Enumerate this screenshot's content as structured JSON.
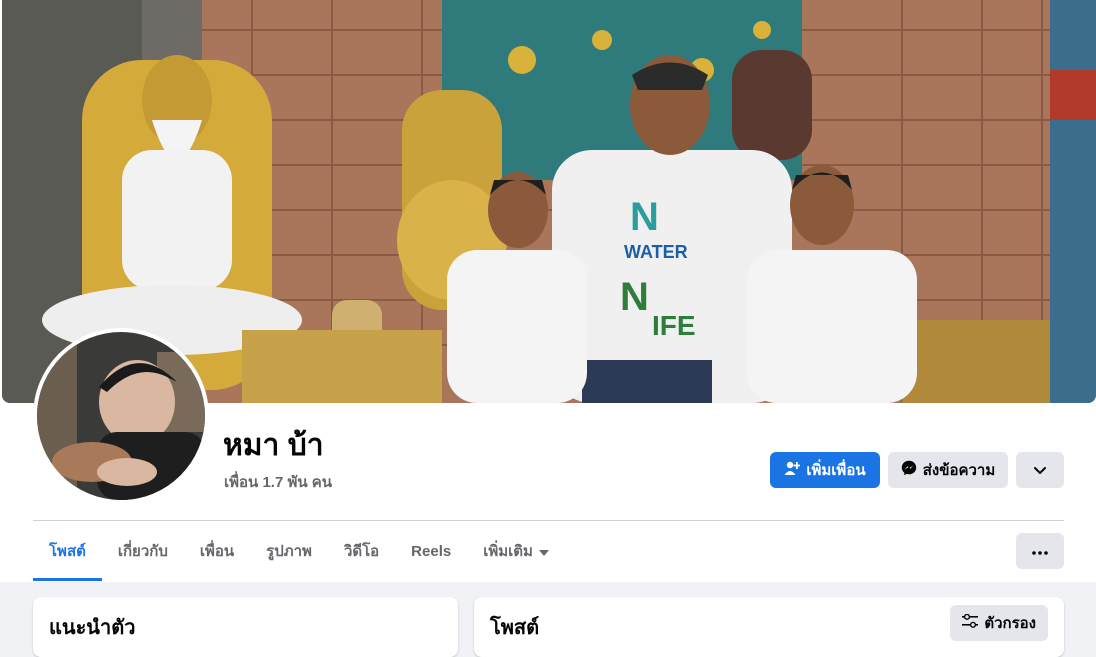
{
  "profile": {
    "name": "หมา บ้า",
    "friends_count": "เพื่อน 1.7 พัน คน"
  },
  "actions": {
    "add_friend": "เพิ่มเพื่อน",
    "message": "ส่งข้อความ"
  },
  "tabs": [
    {
      "label": "โพสต์",
      "active": true
    },
    {
      "label": "เกี่ยวกับ",
      "active": false
    },
    {
      "label": "เพื่อน",
      "active": false
    },
    {
      "label": "รูปภาพ",
      "active": false
    },
    {
      "label": "วิดีโอ",
      "active": false
    },
    {
      "label": "Reels",
      "active": false
    },
    {
      "label": "เพิ่มเติม",
      "active": false
    }
  ],
  "intro_card": {
    "title": "แนะนำตัว"
  },
  "posts_card": {
    "title": "โพสต์",
    "filter_label": "ตัวกรอง"
  },
  "cover_shirt_text": {
    "line1": "N",
    "line2": "WATER",
    "line3": "N",
    "line4": "IFE"
  },
  "colors": {
    "accent": "#1b74e4",
    "secondary_btn": "#e4e6eb",
    "muted_text": "#65676b"
  }
}
